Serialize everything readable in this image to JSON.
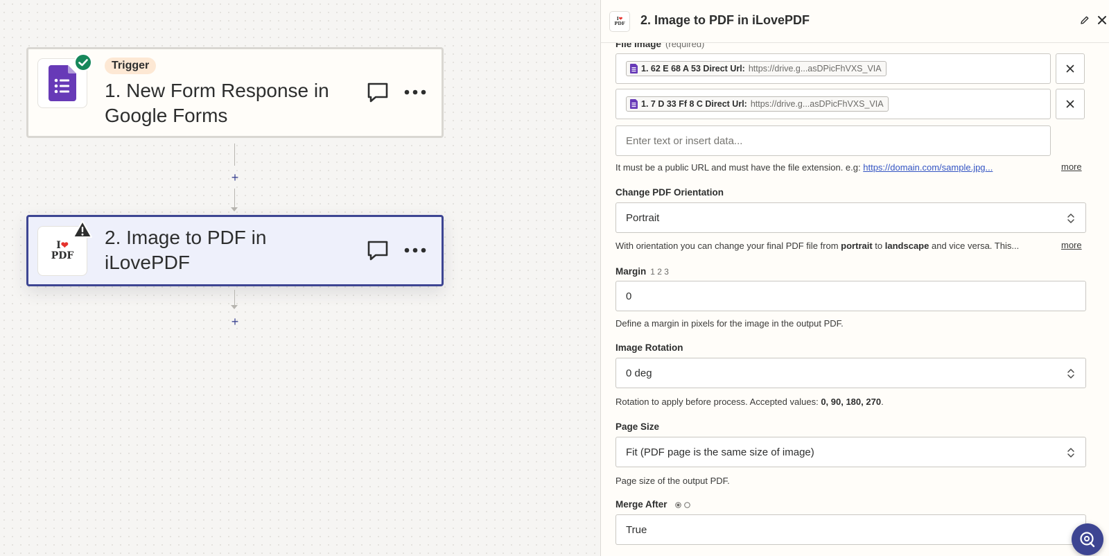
{
  "canvas": {
    "steps": [
      {
        "badge": "Trigger",
        "title": "1. New Form Response in Google Forms",
        "status": "complete",
        "app_icon": "google-forms-icon"
      },
      {
        "title": "2. Image to PDF in iLovePDF",
        "status": "warning",
        "app_icon": "ilovepdf-icon"
      }
    ],
    "add_step_symbol": "+",
    "ilovepdf_logo_top": "I",
    "ilovepdf_logo_bottom": "PDF"
  },
  "panel": {
    "title": "2. Image to PDF in iLovePDF",
    "fields": {
      "file_image": {
        "label": "File Image",
        "required_text": "(required)",
        "chips": [
          {
            "key": "1. 62 E 68 A 53 Direct Url:",
            "value": "https://drive.g...asDPicFhVXS_VIA"
          },
          {
            "key": "1. 7 D 33 Ff 8 C Direct Url:",
            "value": "https://drive.g...asDPicFhVXS_VIA"
          }
        ],
        "placeholder": "Enter text or insert data...",
        "help_prefix": "It must be a public URL and must have the file extension. e.g:",
        "help_link": "https://domain.com/sample.jpg...",
        "more": "more"
      },
      "orientation": {
        "label": "Change PDF Orientation",
        "value": "Portrait",
        "help_1": "With orientation you can change your final PDF file from",
        "help_bold_1": "portrait",
        "help_2": "to",
        "help_bold_2": "landscape",
        "help_3": "and vice versa. This...",
        "more": "more"
      },
      "margin": {
        "label": "Margin",
        "meta": "1 2 3",
        "value": "0",
        "help": "Define a margin in pixels for the image in the output PDF."
      },
      "rotation": {
        "label": "Image Rotation",
        "value": "0 deg",
        "help_prefix": "Rotation to apply before process. Accepted values:",
        "help_values": "0, 90, 180, 270",
        "help_suffix": "."
      },
      "page_size": {
        "label": "Page Size",
        "value": "Fit (PDF page is the same size of image)",
        "help": "Page size of the output PDF."
      },
      "merge_after": {
        "label": "Merge After",
        "value": "True"
      }
    }
  },
  "colors": {
    "accent": "#3d4592",
    "success": "#16875a",
    "warning": "#2d2e2e",
    "google_forms": "#673ab7",
    "ilovepdf_red": "#e5322d"
  }
}
